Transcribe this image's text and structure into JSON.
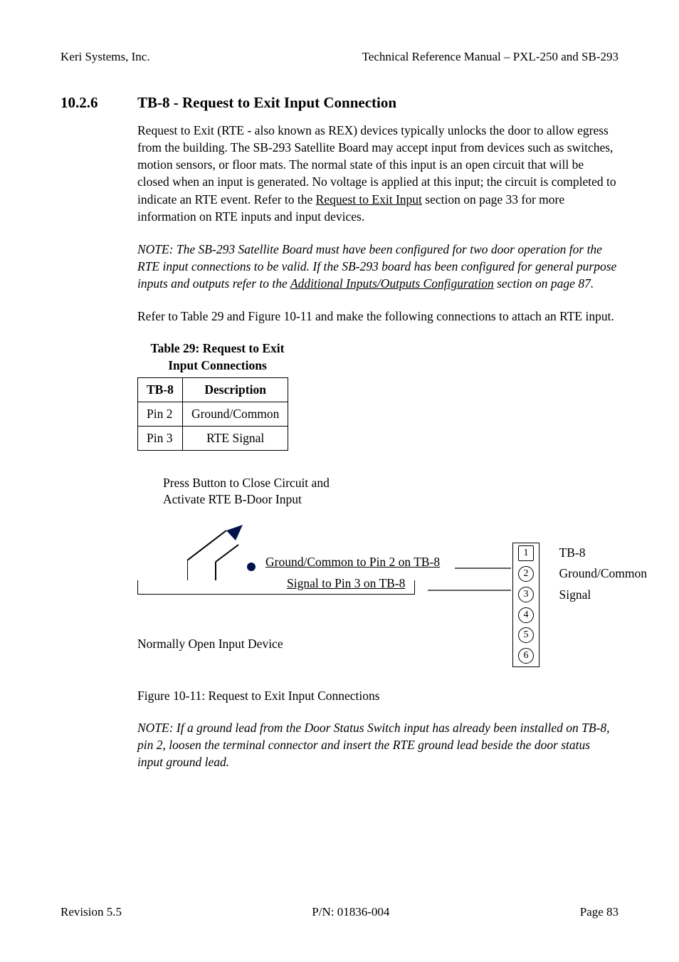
{
  "header": {
    "left": "Keri Systems, Inc.",
    "right": "Technical Reference Manual – PXL-250 and SB-293"
  },
  "section": {
    "number": "10.2.6",
    "title": "TB-8 - Request to Exit Input Connection"
  },
  "para1_pre": "Request to Exit (RTE - also known as REX) devices typically unlocks the door to allow egress from the building. The SB-293 Satellite Board may accept input from devices such as switches, motion sensors, or floor mats. The normal state of this input is an open circuit that will be closed when an input is generated. No voltage is applied at this input; the circuit is completed to indicate an RTE event. Refer to the ",
  "para1_link": "Request to Exit Input",
  "para1_post": " section on page 33 for more information on RTE inputs and input devices.",
  "note1_pre": "NOTE: The SB-293 Satellite Board must have been configured for two door operation for the RTE input connections to be valid. If the SB-293 board has been configured for general purpose inputs and outputs refer to the ",
  "note1_link": "Additional Inputs/Outputs Configuration",
  "note1_post": " section on page 87.",
  "para2": "Refer to Table 29 and Figure 10-11 and make the following connections to attach an RTE input.",
  "table": {
    "caption_l1": "Table 29: Request to Exit",
    "caption_l2": "Input Connections",
    "head_c1": "TB-8",
    "head_c2": "Description",
    "rows": [
      {
        "c1": "Pin 2",
        "c2": "Ground/Common"
      },
      {
        "c1": "Pin 3",
        "c2": "RTE Signal"
      }
    ]
  },
  "figure": {
    "top_l1": "Press Button to Close Circuit and",
    "top_l2": "Activate RTE B-Door Input",
    "wire1": "Ground/Common to Pin 2 on TB-8",
    "wire2": "Signal to Pin 3 on TB-8",
    "normally_open": "Normally Open Input Device",
    "term_title": "TB-8",
    "term_l1": "Ground/Common",
    "term_l2": "Signal",
    "pins": [
      "1",
      "2",
      "3",
      "4",
      "5",
      "6"
    ]
  },
  "figure_caption": "Figure 10-11: Request to Exit Input Connections",
  "note2": "NOTE: If a ground lead from the Door Status Switch input has already been installed on TB-8, pin 2, loosen the terminal connector and insert the RTE ground lead beside the door status input ground lead.",
  "footer": {
    "left": "Revision 5.5",
    "center": "P/N: 01836-004",
    "right": "Page 83"
  }
}
